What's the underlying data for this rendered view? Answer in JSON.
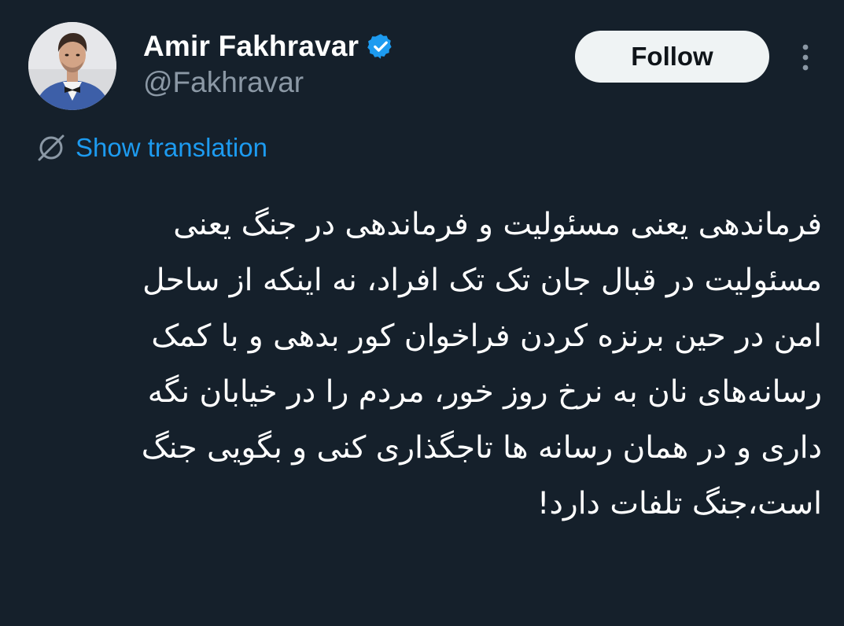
{
  "author": {
    "display_name": "Amir Fakhravar",
    "handle": "@Fakhravar",
    "verified_icon": "verified-badge-icon"
  },
  "actions": {
    "follow_label": "Follow",
    "more_icon": "more-vertical-icon"
  },
  "translation": {
    "icon": "globe-slash-icon",
    "label": "Show translation"
  },
  "tweet": {
    "lines": [
      "فرماندهی یعنی مسئولیت و فرماندهی در جنگ یعنی",
      "مسئولیت در قبال جان تک تک افراد، نه اینکه از ساحل",
      "امن در حین برنزه کردن فراخوان کور بدهی و با کمک",
      "رسانه‌های نان به نرخ روز خور، مردم را در خیابان نگه",
      "داری و در همان رسانه ها تاجگذاری کنی و بگویی جنگ",
      "است،جنگ تلفات دارد!"
    ]
  },
  "colors": {
    "background": "#15202b",
    "accent": "#1d9bf0",
    "secondary_text": "#8b98a5",
    "follow_bg": "#eff3f4"
  }
}
